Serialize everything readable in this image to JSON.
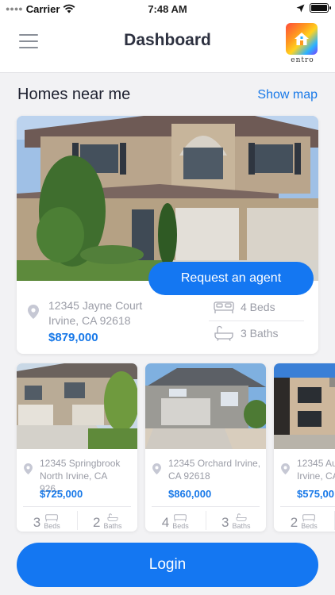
{
  "status_bar": {
    "carrier": "Carrier",
    "time": "7:48 AM",
    "battery_level": 1.0
  },
  "header": {
    "title": "Dashboard",
    "logo_text": "entro"
  },
  "section": {
    "heading": "Homes near me",
    "map_link": "Show map"
  },
  "featured": {
    "address_line1": "12345 Jayne Court",
    "address_line2": "Irvine, CA 92618",
    "price": "$879,000",
    "beds": "4 Beds",
    "baths": "3 Baths",
    "request_button": "Request an agent"
  },
  "listings": [
    {
      "address_line1": "12345 Springbrook",
      "address_line2": "North Irvine, CA 926...",
      "price": "$725,000",
      "beds": "3",
      "baths": "2",
      "beds_label": "Beds",
      "baths_label": "Baths"
    },
    {
      "address_line1": "12345 Orchard Irvine,",
      "address_line2": "CA 92618",
      "price": "$860,000",
      "beds": "4",
      "baths": "3",
      "beds_label": "Beds",
      "baths_label": "Baths"
    },
    {
      "address_line1": "12345 Aul",
      "address_line2": "Irvine, CA",
      "price": "$575,00",
      "beds": "2",
      "baths": "",
      "beds_label": "Beds",
      "baths_label": ""
    }
  ],
  "login_button": "Login",
  "colors": {
    "accent": "#1477f2",
    "link": "#1778e8"
  }
}
